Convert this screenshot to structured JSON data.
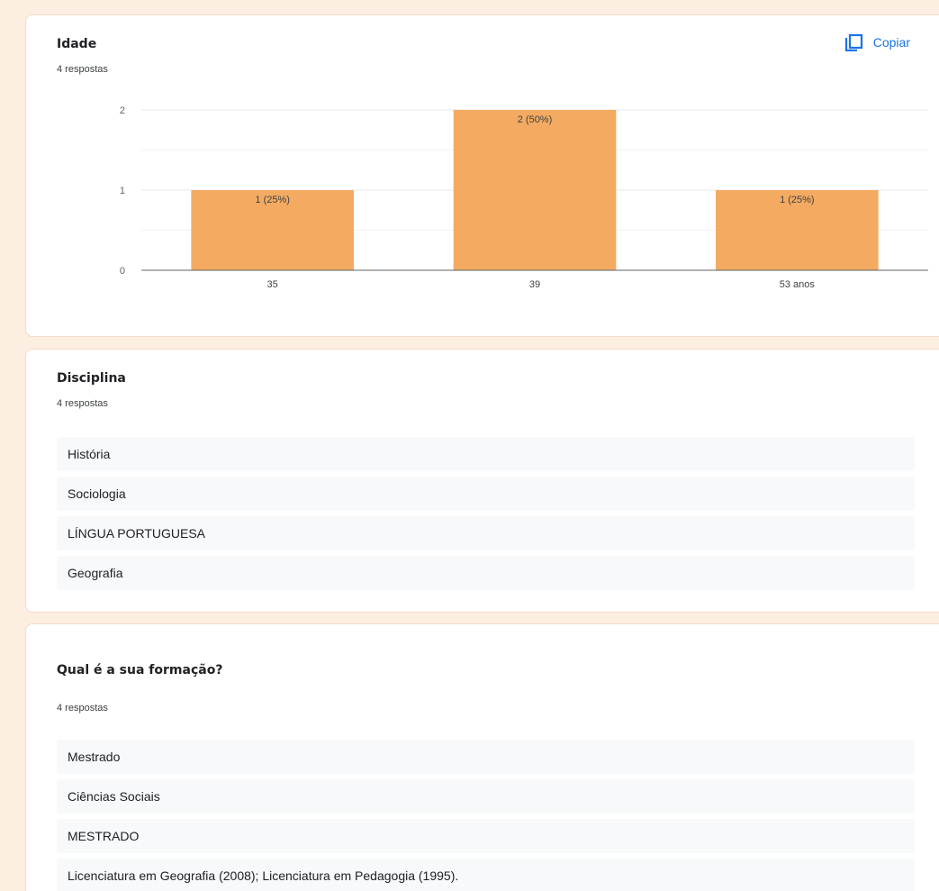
{
  "cards": {
    "idade": {
      "title": "Idade",
      "count": "4 respostas",
      "copy_label": "Copiar"
    },
    "disciplina": {
      "title": "Disciplina",
      "count": "4 respostas",
      "responses": [
        "História",
        "Sociologia",
        "LÍNGUA PORTUGUESA",
        "Geografia"
      ]
    },
    "formacao": {
      "title": "Qual é a sua formação?",
      "count": "4 respostas",
      "responses": [
        "Mestrado",
        "Ciências Sociais",
        "MESTRADO",
        "Licenciatura em Geografia (2008); Licenciatura em Pedagogia (1995)."
      ]
    }
  },
  "icons": {
    "copy": "copy-icon"
  },
  "colors": {
    "bar": "#f4ab61",
    "accent": "#1a73e8",
    "background": "#fdeee2"
  },
  "chart_data": {
    "type": "bar",
    "categories": [
      "35",
      "39",
      "53 anos"
    ],
    "values": [
      1,
      2,
      1
    ],
    "labels": [
      "1 (25%)",
      "2 (50%)",
      "1 (25%)"
    ],
    "yticks": [
      "0",
      "1",
      "2"
    ],
    "ylim": [
      0,
      2
    ],
    "grid": true
  }
}
